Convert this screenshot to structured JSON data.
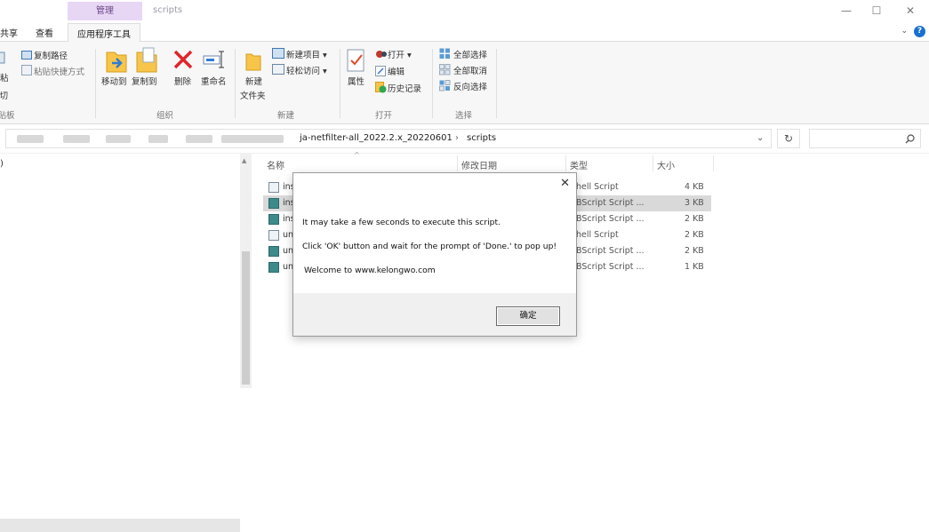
{
  "window": {
    "context_tab_label": "管理",
    "title": "scripts",
    "minimize": "—",
    "maximize": "☐",
    "close": "✕"
  },
  "menu_tabs": [
    {
      "label": "共享"
    },
    {
      "label": "查看"
    },
    {
      "label": "应用程序工具"
    }
  ],
  "collapse_ribbon": "⌄",
  "help": "?",
  "ribbon": {
    "clipboard": {
      "copy_path": "复制路径",
      "paste_shortcut": "粘贴快捷方式",
      "partial_paste": "粘",
      "cut": "剪切",
      "group": "剪贴板"
    },
    "organize": {
      "move_to": "移动到",
      "copy_to": "复制到",
      "delete": "删除",
      "rename": "重命名",
      "group": "组织"
    },
    "new": {
      "new_folder": "新建",
      "new_folder_2": "文件夹",
      "new_item": "新建项目",
      "easy_access": "轻松访问",
      "group": "新建"
    },
    "open": {
      "properties": "属性",
      "open": "打开",
      "edit": "编辑",
      "history": "历史记录",
      "group": "打开"
    },
    "select": {
      "select_all": "全部选择",
      "select_none": "全部取消",
      "invert": "反向选择",
      "group": "选择"
    }
  },
  "address": {
    "crumb_1": "ja-netfilter-all_2022.2.x_20220601",
    "sep_1": "›",
    "crumb_2": "scripts",
    "dropdown": "⌄",
    "refresh": "↻"
  },
  "nav_pane_fragment": ")",
  "columns": {
    "name": "名称",
    "modified": "修改日期",
    "type": "类型",
    "size": "大小"
  },
  "files": [
    {
      "name": "ins",
      "type": "hell Script",
      "size": "4 KB",
      "icon": "shell-file-icon",
      "selected": false
    },
    {
      "name": "ins",
      "type": "BScript Script ...",
      "size": "3 KB",
      "icon": "vbs-file-icon",
      "selected": true
    },
    {
      "name": "ins",
      "type": "BScript Script ...",
      "size": "2 KB",
      "icon": "vbs-file-icon",
      "selected": false
    },
    {
      "name": "un",
      "type": "hell Script",
      "size": "2 KB",
      "icon": "shell-file-icon",
      "selected": false
    },
    {
      "name": "un",
      "type": "BScript Script ...",
      "size": "2 KB",
      "icon": "vbs-file-icon",
      "selected": false
    },
    {
      "name": "un",
      "type": "BScript Script ...",
      "size": "1 KB",
      "icon": "vbs-file-icon",
      "selected": false
    }
  ],
  "dialog": {
    "line_1": "It may take a few seconds to execute this script.",
    "line_2": "Click 'OK' button and wait for the prompt of 'Done.' to pop up!",
    "line_3": "Welcome to www.kelongwo.com",
    "ok": "确定",
    "close": "✕"
  }
}
